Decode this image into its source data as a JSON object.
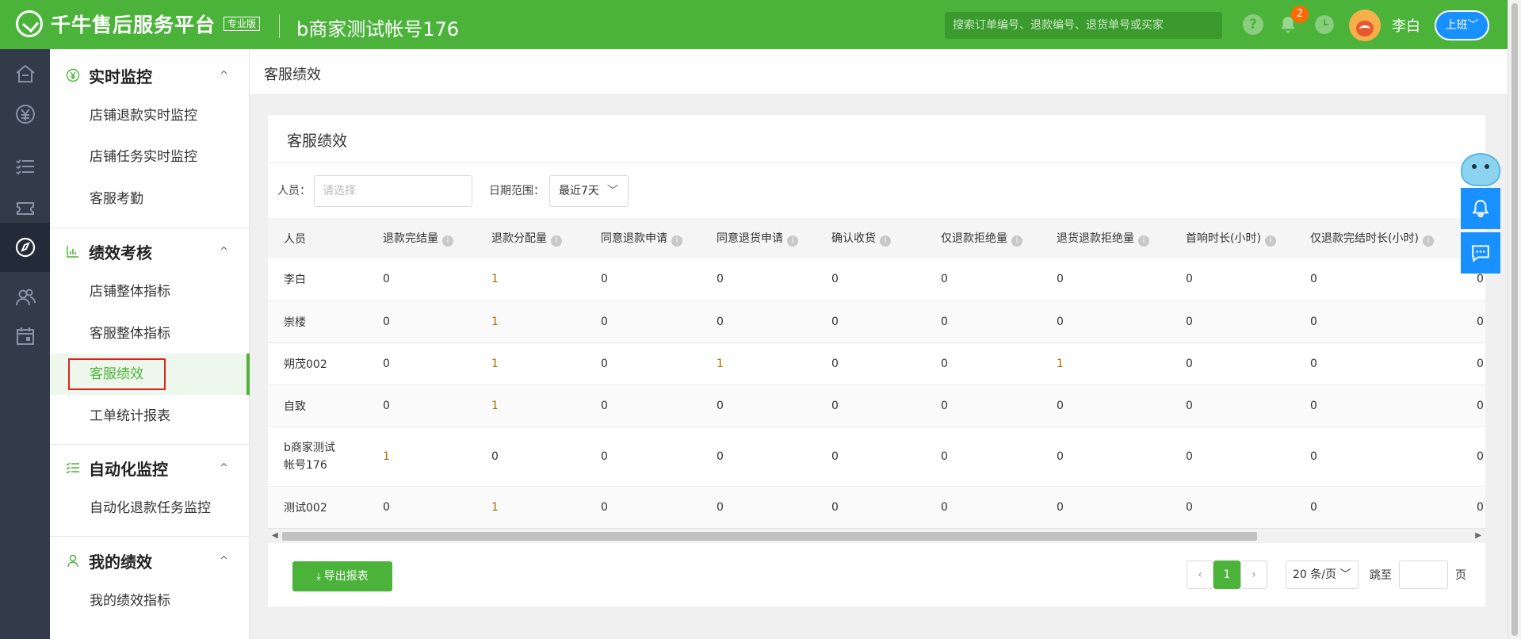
{
  "header": {
    "logo_text": "千牛售后服务平台",
    "edition_badge": "专业版",
    "account_title": "b商家测试帐号176",
    "search_placeholder": "搜索订单编号、退款编号、退货单号或买家",
    "notification_count": "2",
    "username": "李白",
    "shift_button": "上班",
    "shift_chevron": "﹀"
  },
  "sidebar": {
    "groups": [
      {
        "title": "实时监控",
        "caret": "^",
        "items": [
          "店铺退款实时监控",
          "店铺任务实时监控",
          "客服考勤"
        ]
      },
      {
        "title": "绩效考核",
        "caret": "^",
        "items": [
          "店铺整体指标",
          "客服整体指标",
          "客服绩效",
          "工单统计报表"
        ]
      },
      {
        "title": "自动化监控",
        "caret": "^",
        "items": [
          "自动化退款任务监控"
        ]
      },
      {
        "title": "我的绩效",
        "caret": "^",
        "items": [
          "我的绩效指标"
        ]
      }
    ],
    "active_item": "客服绩效"
  },
  "breadcrumb": {
    "title": "客服绩效"
  },
  "card": {
    "title": "客服绩效",
    "person_label": "人员：",
    "person_placeholder": "请选择",
    "date_label": "日期范围：",
    "date_value": "最近7天",
    "date_chevron": "﹀"
  },
  "table": {
    "columns": [
      "人员",
      "退款完结量",
      "退款分配量",
      "同意退款申请",
      "同意退货申请",
      "确认收货",
      "仅退款拒绝量",
      "退货退款拒绝量",
      "首响时长(小时)",
      "仅退款完结时长(小时)",
      ""
    ],
    "info_icon": "i",
    "rows": [
      [
        "李白",
        "0",
        "1",
        "0",
        "0",
        "0",
        "0",
        "0",
        "0",
        "0",
        "0"
      ],
      [
        "崇楼",
        "0",
        "1",
        "0",
        "0",
        "0",
        "0",
        "0",
        "0",
        "0",
        "0"
      ],
      [
        "朔茂002",
        "0",
        "1",
        "0",
        "1",
        "0",
        "0",
        "1",
        "0",
        "0",
        "0"
      ],
      [
        "自致",
        "0",
        "1",
        "0",
        "0",
        "0",
        "0",
        "0",
        "0",
        "0",
        "0"
      ],
      [
        "b商家测试帐号176",
        "1",
        "0",
        "0",
        "0",
        "0",
        "0",
        "0",
        "0",
        "0",
        "0"
      ],
      [
        "测试002",
        "0",
        "1",
        "0",
        "0",
        "0",
        "0",
        "0",
        "0",
        "0",
        "0"
      ]
    ]
  },
  "footer": {
    "export_label": "导出报表",
    "prev": "‹",
    "current_page": "1",
    "next": "›",
    "page_size": "20 条/页",
    "page_size_chevron": "﹀",
    "jump_label": "跳至",
    "page_unit": "页"
  },
  "colors": {
    "brand": "#4bb33a",
    "accent_blue": "#1890ff",
    "rail": "#333b4b"
  }
}
